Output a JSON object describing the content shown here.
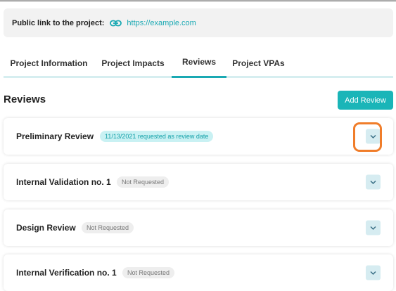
{
  "public_link": {
    "label": "Public link to the project:",
    "icon": "link-icon",
    "url": "https://example.com"
  },
  "tabs": [
    {
      "label": "Project Information",
      "active": false
    },
    {
      "label": "Project Impacts",
      "active": false
    },
    {
      "label": "Reviews",
      "active": true
    },
    {
      "label": "Project VPAs",
      "active": false
    }
  ],
  "section": {
    "title": "Reviews",
    "add_button_label": "Add Review"
  },
  "reviews": [
    {
      "name": "Preliminary Review",
      "status": "11/13/2021 requested as review date",
      "status_style": "requested"
    },
    {
      "name": "Internal Validation no. 1",
      "status": "Not Requested",
      "status_style": "not-requested"
    },
    {
      "name": "Design Review",
      "status": "Not Requested",
      "status_style": "not-requested"
    },
    {
      "name": "Internal Verification no. 1",
      "status": "Not Requested",
      "status_style": "not-requested"
    }
  ],
  "colors": {
    "accent": "#1ab5b8",
    "link": "#1aa9b3",
    "highlight": "#f07d2a"
  }
}
